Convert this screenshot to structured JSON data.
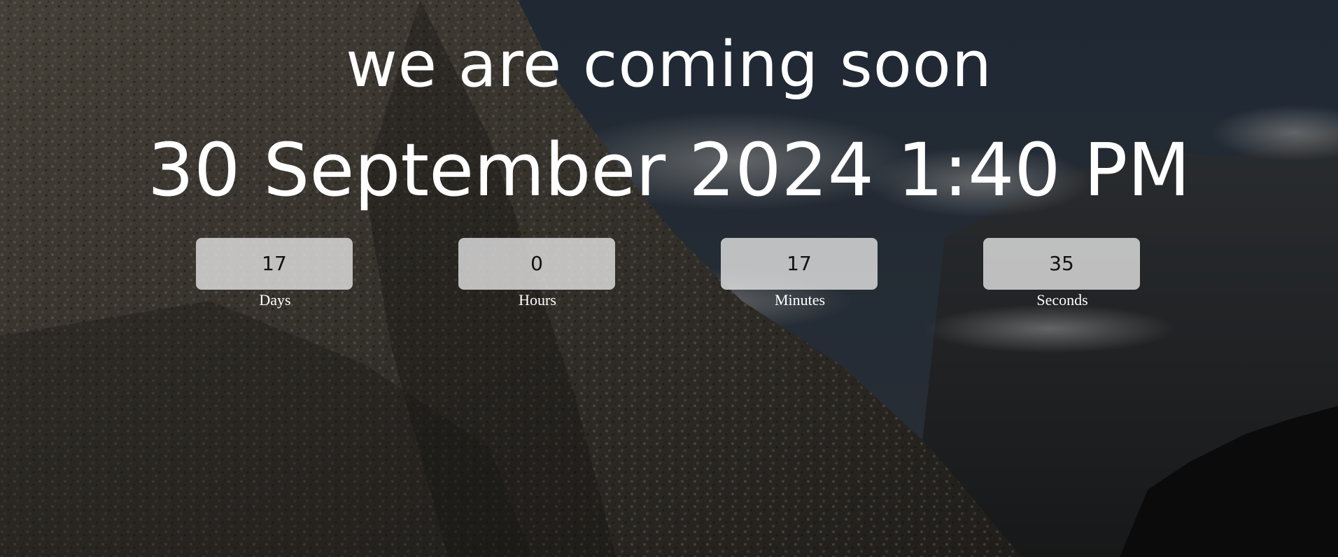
{
  "page": {
    "headline": "we are coming soon",
    "target_datetime": "30 September 2024 1:40 PM",
    "background_image": "mountain-landscape"
  },
  "countdown": {
    "days": {
      "value": "17",
      "label": "Days"
    },
    "hours": {
      "value": "0",
      "label": "Hours"
    },
    "minutes": {
      "value": "17",
      "label": "Minutes"
    },
    "seconds": {
      "value": "35",
      "label": "Seconds"
    }
  },
  "colors": {
    "text": "#ffffff",
    "box_bg": "#e1e1e1",
    "box_text": "#111111",
    "sky": "#2a3340",
    "rock": "#6b6358"
  }
}
